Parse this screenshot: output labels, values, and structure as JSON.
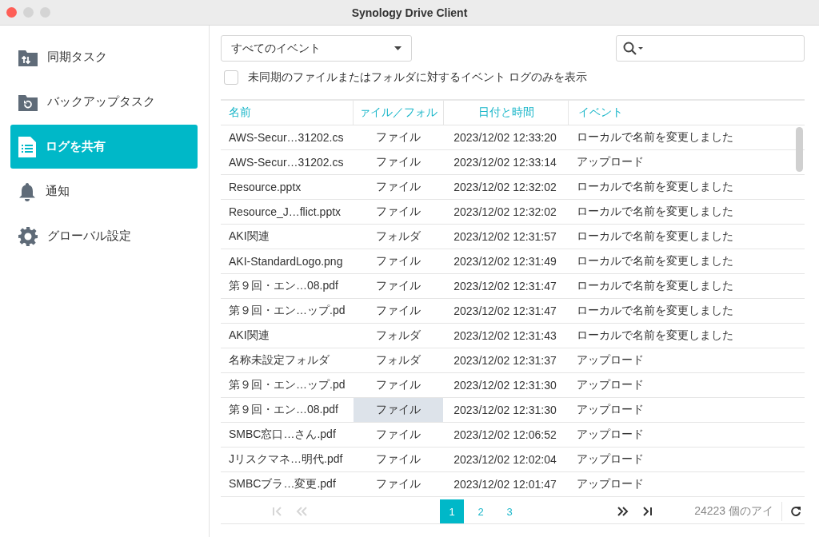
{
  "window": {
    "title": "Synology Drive Client"
  },
  "sidebar": {
    "items": [
      {
        "label": "同期タスク",
        "kind": "sync",
        "selected": false
      },
      {
        "label": "バックアップタスク",
        "kind": "backup",
        "selected": false
      },
      {
        "label": "ログを共有",
        "kind": "log",
        "selected": true
      },
      {
        "label": "通知",
        "kind": "bell",
        "selected": false
      },
      {
        "label": "グローバル設定",
        "kind": "gear",
        "selected": false
      }
    ]
  },
  "filter": {
    "value": "すべてのイベント"
  },
  "unsynced_only": {
    "label": "未同期のファイルまたはフォルダに対するイベント ログのみを表示",
    "checked": false
  },
  "table": {
    "columns": [
      "名前",
      "ァイル／フォル",
      "日付と時間",
      "イベント"
    ],
    "rows": [
      {
        "name": "AWS-Secur…31202.cs",
        "type": "ファイル",
        "date": "2023/12/02 12:33:20",
        "event": "ローカルで名前を変更しました",
        "hovered": false
      },
      {
        "name": "AWS-Secur…31202.cs",
        "type": "ファイル",
        "date": "2023/12/02 12:33:14",
        "event": "アップロード",
        "hovered": false
      },
      {
        "name": "Resource.pptx",
        "type": "ファイル",
        "date": "2023/12/02 12:32:02",
        "event": "ローカルで名前を変更しました",
        "hovered": false
      },
      {
        "name": "Resource_J…flict.pptx",
        "type": "ファイル",
        "date": "2023/12/02 12:32:02",
        "event": "ローカルで名前を変更しました",
        "hovered": false
      },
      {
        "name": "AKI関連",
        "type": "フォルダ",
        "date": "2023/12/02 12:31:57",
        "event": "ローカルで名前を変更しました",
        "hovered": false
      },
      {
        "name": "AKI-StandardLogo.png",
        "type": "ファイル",
        "date": "2023/12/02 12:31:49",
        "event": "ローカルで名前を変更しました",
        "hovered": false
      },
      {
        "name": "第９回・エン…08.pdf",
        "type": "ファイル",
        "date": "2023/12/02 12:31:47",
        "event": "ローカルで名前を変更しました",
        "hovered": false
      },
      {
        "name": "第９回・エン…ップ.pd",
        "type": "ファイル",
        "date": "2023/12/02 12:31:47",
        "event": "ローカルで名前を変更しました",
        "hovered": false
      },
      {
        "name": "AKI関連",
        "type": "フォルダ",
        "date": "2023/12/02 12:31:43",
        "event": "ローカルで名前を変更しました",
        "hovered": false
      },
      {
        "name": "名称未設定フォルダ",
        "type": "フォルダ",
        "date": "2023/12/02 12:31:37",
        "event": "アップロード",
        "hovered": false
      },
      {
        "name": "第９回・エン…ップ.pd",
        "type": "ファイル",
        "date": "2023/12/02 12:31:30",
        "event": "アップロード",
        "hovered": false
      },
      {
        "name": "第９回・エン…08.pdf",
        "type": "ファイル",
        "date": "2023/12/02 12:31:30",
        "event": "アップロード",
        "hovered": true
      },
      {
        "name": "SMBC窓口…さん.pdf",
        "type": "ファイル",
        "date": "2023/12/02 12:06:52",
        "event": "アップロード",
        "hovered": false
      },
      {
        "name": "Jリスクマネ…明代.pdf",
        "type": "ファイル",
        "date": "2023/12/02 12:02:04",
        "event": "アップロード",
        "hovered": false
      },
      {
        "name": "SMBCブラ…変更.pdf",
        "type": "ファイル",
        "date": "2023/12/02 12:01:47",
        "event": "アップロード",
        "hovered": false
      }
    ]
  },
  "pagination": {
    "nav_left": [
      {
        "kind": "first",
        "disabled": true
      },
      {
        "kind": "prev",
        "disabled": true
      }
    ],
    "pages": [
      {
        "label": "1",
        "selected": true
      },
      {
        "label": "2",
        "selected": false
      },
      {
        "label": "3",
        "selected": false
      }
    ],
    "nav_right": [
      {
        "kind": "next",
        "disabled": false
      },
      {
        "kind": "last",
        "disabled": false
      }
    ],
    "count": "24223 個のアイ"
  }
}
